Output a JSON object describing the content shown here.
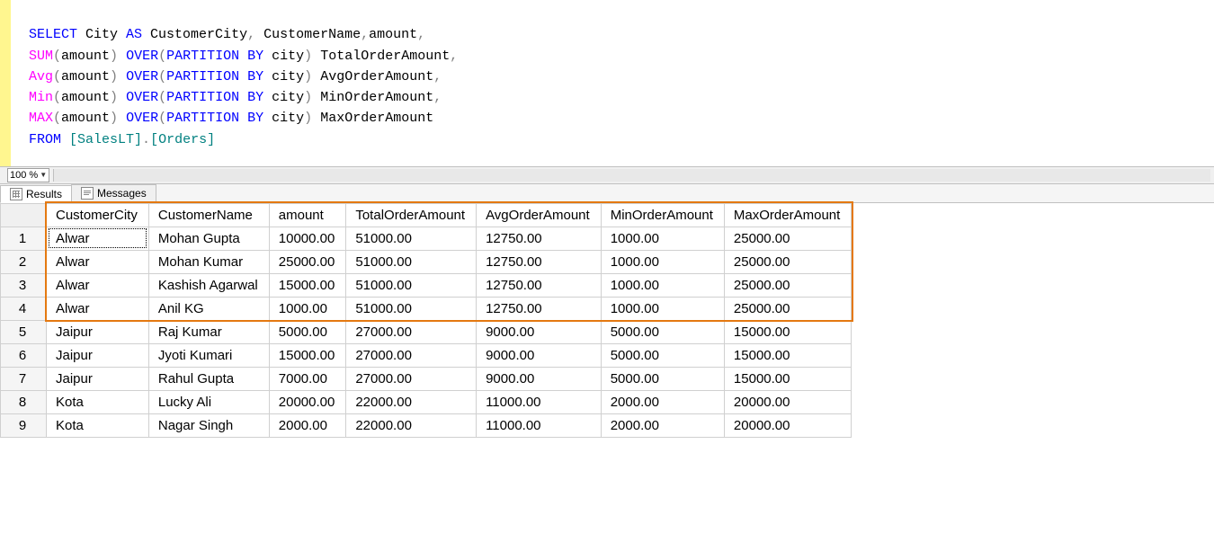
{
  "code": {
    "l1": {
      "a": "SELECT",
      "b": " City ",
      "c": "AS",
      "d": " CustomerCity",
      "comma1": ",",
      "e": " CustomerName",
      "comma2": ",",
      "f": "amount",
      "comma3": ","
    },
    "l2": {
      "a": "SUM",
      "lp": "(",
      "b": "amount",
      "rp": ")",
      "sp": " ",
      "c": "OVER",
      "lp2": "(",
      "d": "PARTITION",
      "sp2": " ",
      "e": "BY",
      "f": " city",
      "rp2": ")",
      "g": " TotalOrderAmount",
      "comma": ","
    },
    "l3": {
      "a": "Avg",
      "lp": "(",
      "b": "amount",
      "rp": ")",
      "sp": " ",
      "c": "OVER",
      "lp2": "(",
      "d": "PARTITION",
      "sp2": " ",
      "e": "BY",
      "f": " city",
      "rp2": ")",
      "g": " AvgOrderAmount",
      "comma": ","
    },
    "l4": {
      "a": "Min",
      "lp": "(",
      "b": "amount",
      "rp": ")",
      "sp": " ",
      "c": "OVER",
      "lp2": "(",
      "d": "PARTITION",
      "sp2": " ",
      "e": "BY",
      "f": " city",
      "rp2": ")",
      "g": " MinOrderAmount",
      "comma": ","
    },
    "l5": {
      "a": "MAX",
      "lp": "(",
      "b": "amount",
      "rp": ")",
      "sp": " ",
      "c": "OVER",
      "lp2": "(",
      "d": "PARTITION",
      "sp2": " ",
      "e": "BY",
      "f": " city",
      "rp2": ")",
      "g": " MaxOrderAmount"
    },
    "l6": {
      "a": "FROM",
      "sp": " ",
      "b": "[SalesLT]",
      "dot": ".",
      "c": "[Orders]"
    }
  },
  "zoom": {
    "value": "100 %"
  },
  "tabs": {
    "results": "Results",
    "messages": "Messages"
  },
  "grid": {
    "headers": [
      "CustomerCity",
      "CustomerName",
      "amount",
      "TotalOrderAmount",
      "AvgOrderAmount",
      "MinOrderAmount",
      "MaxOrderAmount"
    ],
    "rows": [
      {
        "n": "1",
        "c": [
          "Alwar",
          "Mohan Gupta",
          "10000.00",
          "51000.00",
          "12750.00",
          "1000.00",
          "25000.00"
        ]
      },
      {
        "n": "2",
        "c": [
          "Alwar",
          "Mohan Kumar",
          "25000.00",
          "51000.00",
          "12750.00",
          "1000.00",
          "25000.00"
        ]
      },
      {
        "n": "3",
        "c": [
          "Alwar",
          "Kashish Agarwal",
          "15000.00",
          "51000.00",
          "12750.00",
          "1000.00",
          "25000.00"
        ]
      },
      {
        "n": "4",
        "c": [
          "Alwar",
          "Anil KG",
          "1000.00",
          "51000.00",
          "12750.00",
          "1000.00",
          "25000.00"
        ]
      },
      {
        "n": "5",
        "c": [
          "Jaipur",
          "Raj Kumar",
          "5000.00",
          "27000.00",
          "9000.00",
          "5000.00",
          "15000.00"
        ]
      },
      {
        "n": "6",
        "c": [
          "Jaipur",
          "Jyoti Kumari",
          "15000.00",
          "27000.00",
          "9000.00",
          "5000.00",
          "15000.00"
        ]
      },
      {
        "n": "7",
        "c": [
          "Jaipur",
          "Rahul Gupta",
          "7000.00",
          "27000.00",
          "9000.00",
          "5000.00",
          "15000.00"
        ]
      },
      {
        "n": "8",
        "c": [
          "Kota",
          "Lucky Ali",
          "20000.00",
          "22000.00",
          "11000.00",
          "2000.00",
          "20000.00"
        ]
      },
      {
        "n": "9",
        "c": [
          "Kota",
          "Nagar Singh",
          "2000.00",
          "22000.00",
          "11000.00",
          "2000.00",
          "20000.00"
        ]
      }
    ]
  },
  "highlight": {
    "row_start": 0,
    "row_end": 4,
    "col_start": 1
  }
}
